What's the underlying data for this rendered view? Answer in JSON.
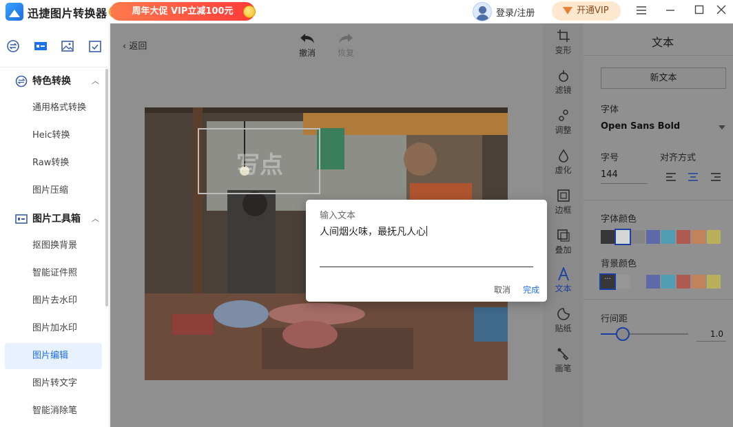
{
  "titlebar": {
    "app_name": "迅捷图片转换器",
    "promo": "周年大促 VIP立减100元",
    "login": "登录/注册",
    "vip_button": "开通VIP",
    "menu_icon": "hamburger-icon",
    "minimize_icon": "minimize-icon",
    "maximize_icon": "maximize-icon",
    "close_icon": "close-icon"
  },
  "sidebar": {
    "top_icons": [
      "convert-icon",
      "toolbox-icon",
      "image-icon",
      "checklist-icon"
    ],
    "groups": [
      {
        "label": "特色转换",
        "items": [
          "通用格式转换",
          "Heic转换",
          "Raw转换",
          "图片压缩"
        ]
      },
      {
        "label": "图片工具箱",
        "items": [
          "抠图换背景",
          "智能证件照",
          "图片去水印",
          "图片加水印",
          "图片编辑",
          "图片转文字",
          "智能消除笔"
        ]
      }
    ],
    "active_item": "图片编辑"
  },
  "editor": {
    "back": "返回",
    "undo": "撤消",
    "redo": "恢复",
    "watermark_text": "写点"
  },
  "tool_column": [
    "变形",
    "滤镜",
    "调整",
    "虚化",
    "边框",
    "叠加",
    "文本",
    "贴纸",
    "画笔"
  ],
  "active_tool": "文本",
  "panel": {
    "title": "文本",
    "new_text_button": "新文本",
    "font_label": "字体",
    "font_value": "Open Sans Bold",
    "size_label": "字号",
    "size_value": "144",
    "align_label": "对齐方式",
    "align_selected": "center",
    "font_color_label": "字体颜色",
    "font_colors": [
      "#000000",
      "#ffffff",
      "#808080",
      "#3f51b5",
      "#2aa6c9",
      "#c0392b",
      "#e07b39",
      "#d4c23b"
    ],
    "bg_color_label": "背景颜色",
    "bg_colors": [
      "#000000",
      "#9a9a9a",
      "#3f51b5",
      "#2aa6c9",
      "#c0392b",
      "#e07b39",
      "#d4c23b"
    ],
    "line_height_label": "行间距",
    "line_height_value": "1.0"
  },
  "dialog": {
    "title": "输入文本",
    "text": "人间烟火味，最抚凡人心",
    "cancel": "取消",
    "confirm": "完成"
  }
}
